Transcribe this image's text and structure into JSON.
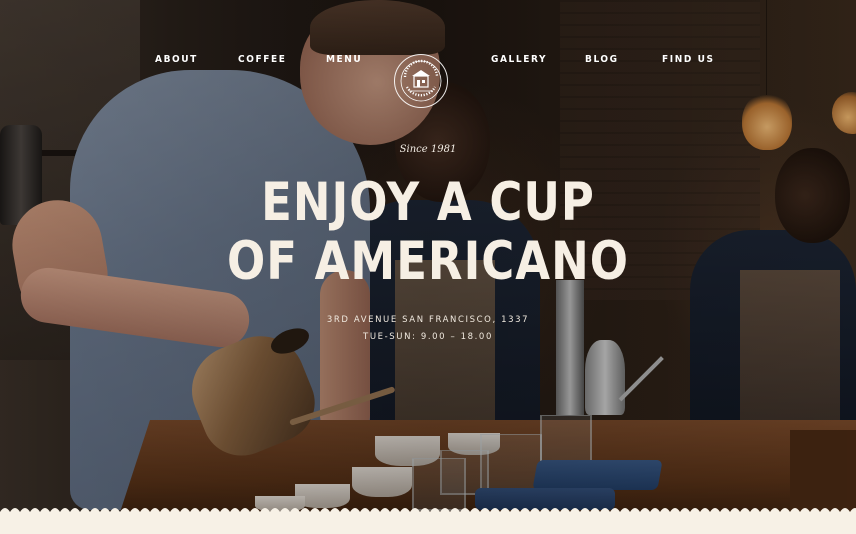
{
  "nav": {
    "items": [
      {
        "label": "ABOUT"
      },
      {
        "label": "COFFEE"
      },
      {
        "label": "MENU"
      },
      {
        "label": "GALLERY"
      },
      {
        "label": "BLOG"
      },
      {
        "label": "FIND US"
      }
    ],
    "logo": {
      "icon": "coffee-shop-logo-icon",
      "top_text": "COFFEE HOUSE",
      "bottom_text": "BREW ROOM"
    }
  },
  "hero": {
    "since": "Since 1981",
    "headline_line1": "ENJOY A CUP",
    "headline_line2": "OF AMERICANO",
    "address": "3RD AVENUE SAN FRANCISCO, 1337",
    "hours": "TUE-SUN: 9.00 – 18.00"
  },
  "colors": {
    "text": "#f6efe4",
    "footer_strip": "#f7f1e6"
  }
}
